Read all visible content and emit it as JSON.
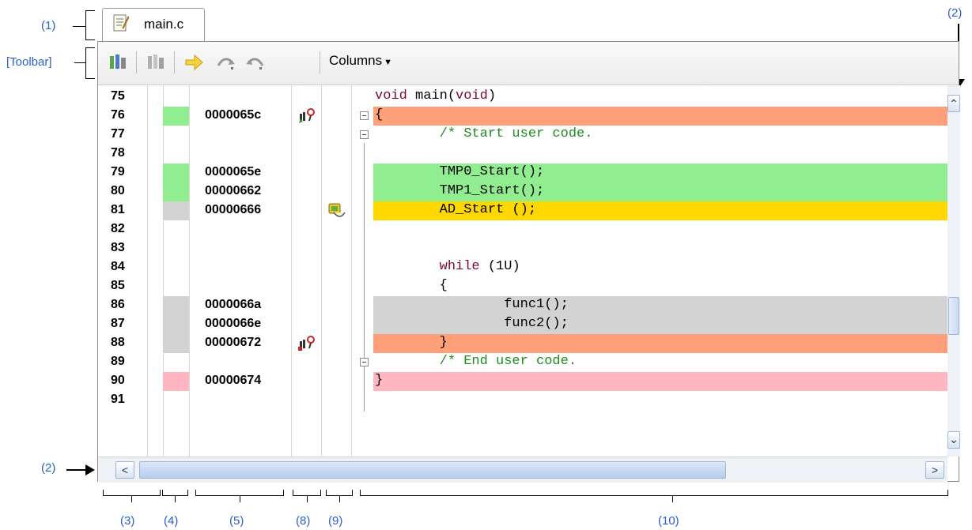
{
  "annotations": {
    "a1": "(1)",
    "a2_top": "(2)",
    "a2_left": "(2)",
    "toolbar": "[Toolbar]",
    "a3": "(3)",
    "a4": "(4)",
    "a5": "(5)",
    "a8": "(8)",
    "a9": "(9)",
    "a10": "(10)"
  },
  "tab": {
    "label": "main.c",
    "icon": "file-edit-icon"
  },
  "toolbar": {
    "buttons": [
      "go-to-source-icon",
      "go-to-disassemble-icon",
      "step-in-icon",
      "step-over-icon",
      "return-out-icon"
    ],
    "columns_label": "Columns"
  },
  "colors": {
    "covered": "#90ee90",
    "uncovered_gray": "#d3d3d3",
    "pc_line": "#ffd700",
    "breakpoint": "#ffa07a",
    "pink": "#ffb6c1",
    "comment": "#1e8c1e",
    "keyword": "#7a0a2a"
  },
  "lines": [
    {
      "num": "75",
      "addr": "",
      "code": "void main(void)"
    },
    {
      "num": "76",
      "addr": "0000065c",
      "code": "{"
    },
    {
      "num": "77",
      "addr": "",
      "code": "        /* Start user code."
    },
    {
      "num": "78",
      "addr": "",
      "code": ""
    },
    {
      "num": "79",
      "addr": "0000065e",
      "code": "        TMP0_Start();"
    },
    {
      "num": "80",
      "addr": "00000662",
      "code": "        TMP1_Start();"
    },
    {
      "num": "81",
      "addr": "00000666",
      "code": "        AD_Start ();"
    },
    {
      "num": "82",
      "addr": "",
      "code": ""
    },
    {
      "num": "83",
      "addr": "",
      "code": ""
    },
    {
      "num": "84",
      "addr": "",
      "code": "        while (1U)"
    },
    {
      "num": "85",
      "addr": "",
      "code": "        {"
    },
    {
      "num": "86",
      "addr": "0000066a",
      "code": "                func1();"
    },
    {
      "num": "87",
      "addr": "0000066e",
      "code": "                func2();"
    },
    {
      "num": "88",
      "addr": "00000672",
      "code": "        }"
    },
    {
      "num": "89",
      "addr": "",
      "code": "        /* End user code."
    },
    {
      "num": "90",
      "addr": "00000674",
      "code": "}"
    },
    {
      "num": "91",
      "addr": "",
      "code": ""
    }
  ]
}
